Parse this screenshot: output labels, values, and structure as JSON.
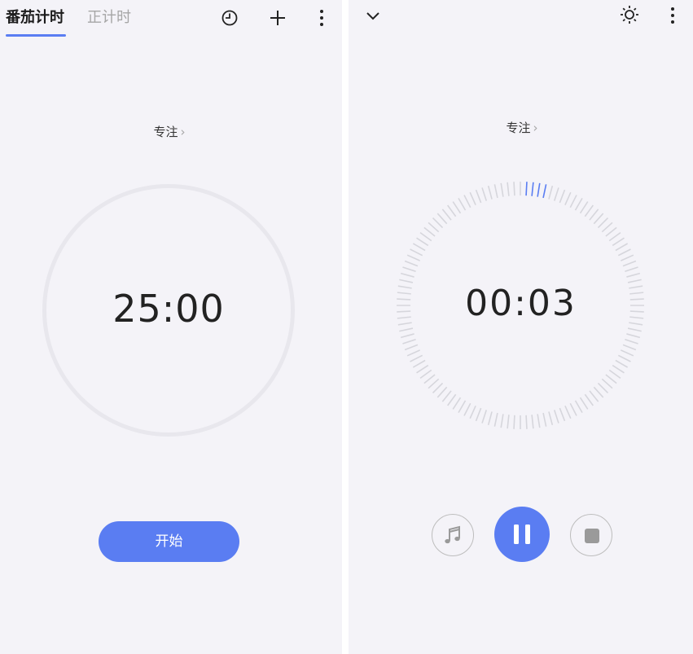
{
  "left": {
    "tabs": [
      {
        "label": "番茄计时",
        "active": true
      },
      {
        "label": "正计时",
        "active": false
      }
    ],
    "icons": [
      "history-icon",
      "add-icon",
      "more-icon"
    ],
    "mode_label": "专注",
    "time": "25:00",
    "start_label": "开始"
  },
  "right": {
    "icons": [
      "collapse-chevron-icon",
      "brightness-icon",
      "more-icon"
    ],
    "mode_label": "专注",
    "time": "00:03",
    "elapsed_seconds": 3,
    "controls": [
      "music-icon",
      "pause-icon",
      "stop-icon"
    ]
  },
  "colors": {
    "accent": "#5a7df2",
    "background": "#f4f3f8",
    "tick": "#d6d6dc"
  }
}
